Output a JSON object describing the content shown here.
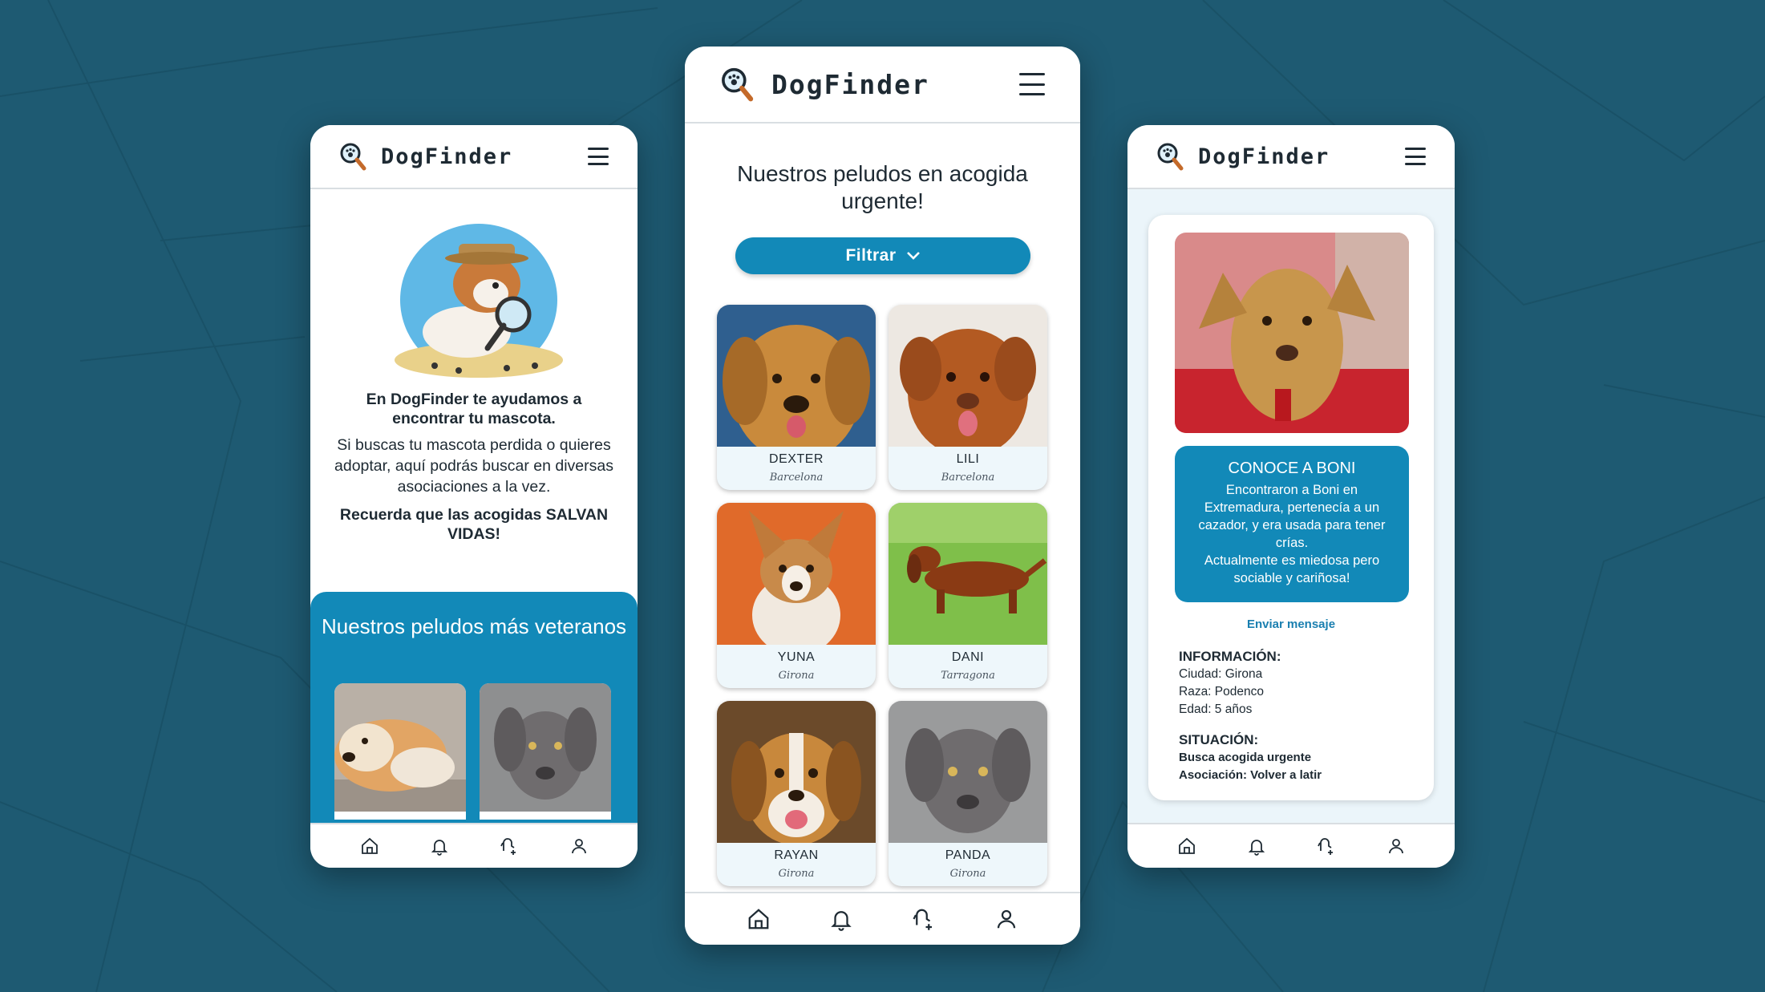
{
  "brand": {
    "name": "DogFinder",
    "accent": "#1289b8",
    "background": "#1e5a72"
  },
  "screen_home": {
    "intro_bold": "En DogFinder te ayudamos a encontrar tu mascota.",
    "intro_text": "Si buscas tu mascota perdida o quieres adoptar, aquí podrás buscar en diversas asociaciones a la vez.",
    "intro_cta": "Recuerda que las acogidas SALVAN VIDAS!",
    "veterans_title": "Nuestros peludos más veteranos"
  },
  "screen_list": {
    "title": "Nuestros peludos en acogida urgente!",
    "filter_label": "Filtrar",
    "dogs": [
      {
        "name": "DEXTER",
        "city": "Barcelona"
      },
      {
        "name": "LILI",
        "city": "Barcelona"
      },
      {
        "name": "YUNA",
        "city": "Girona"
      },
      {
        "name": "DANI",
        "city": "Tarragona"
      },
      {
        "name": "RAYAN",
        "city": "Girona"
      },
      {
        "name": "PANDA",
        "city": "Girona"
      }
    ]
  },
  "screen_detail": {
    "box_title": "CONOCE A BONI",
    "box_text_1": "Encontraron a Boni en Extremadura, pertenecía a un cazador, y era usada para tener crías.",
    "box_text_2": "Actualmente es miedosa pero sociable y cariñosa!",
    "send_message": "Enviar mensaje",
    "info_heading": "INFORMACIÓN:",
    "city": "Ciudad: Girona",
    "breed": "Raza: Podenco",
    "age": "Edad: 5 años",
    "situation_heading": "SITUACIÓN:",
    "situation_1": "Busca acogida urgente",
    "situation_2": "Asociación: Volver a latir"
  },
  "tabbar": {
    "icons": [
      "home-icon",
      "bell-icon",
      "dog-add-icon",
      "user-icon"
    ]
  }
}
